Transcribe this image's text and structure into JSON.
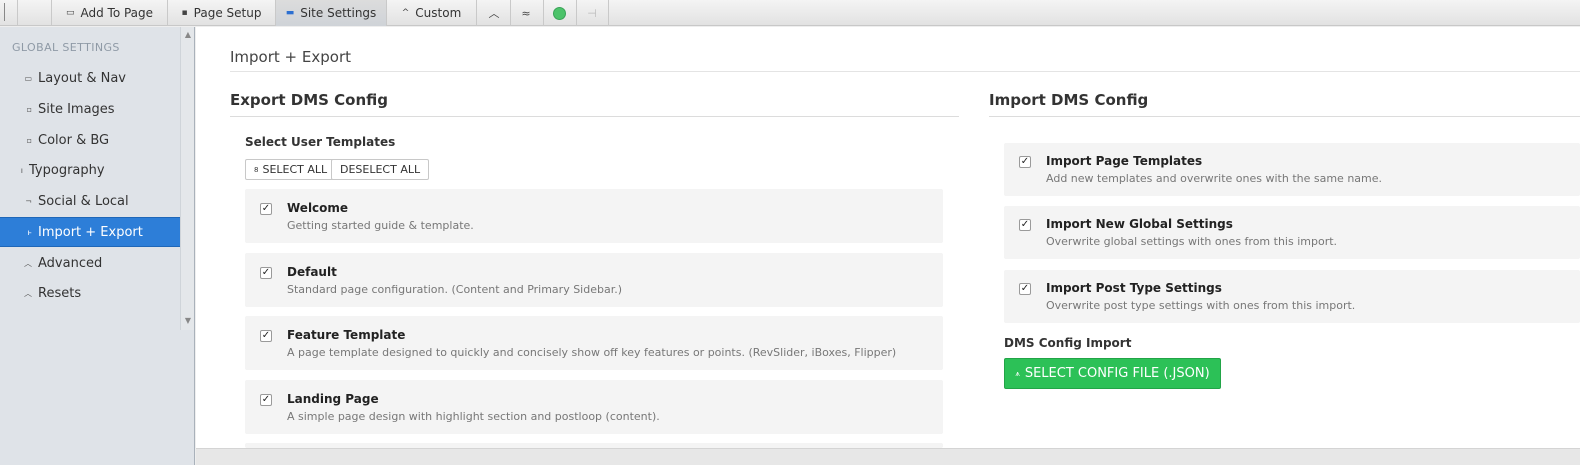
{
  "toolbar": {
    "add_to_page": "Add To Page",
    "page_setup": "Page Setup",
    "site_settings": "Site Settings",
    "custom": "Custom",
    "icons": [
      "drawer-handle-icon",
      "page-icon",
      "page-setup-icon",
      "site-settings-icon",
      "caret-up-icon",
      "chevron-up-icon",
      "double-chevron-icon",
      "status-dot-icon",
      "pin-icon"
    ],
    "status_color": "#4cc36a"
  },
  "sidebar": {
    "heading": "GLOBAL SETTINGS",
    "items": [
      {
        "label": "Layout & Nav",
        "icon": "layout-icon"
      },
      {
        "label": "Site Images",
        "icon": "images-icon"
      },
      {
        "label": "Color & BG",
        "icon": "color-icon"
      },
      {
        "label": "Typography",
        "icon": "typography-icon"
      },
      {
        "label": "Social & Local",
        "icon": "social-icon"
      },
      {
        "label": "Import + Export",
        "icon": "import-export-icon",
        "active": true
      },
      {
        "label": "Advanced",
        "icon": "advanced-icon"
      },
      {
        "label": "Resets",
        "icon": "resets-icon"
      }
    ],
    "accent_color": "#2d7ed8"
  },
  "panel": {
    "title": "Import + Export",
    "export": {
      "title": "Export DMS Config",
      "select_label": "Select User Templates",
      "select_all": "SELECT ALL",
      "deselect_all": "DESELECT ALL",
      "templates": [
        {
          "title": "Welcome",
          "desc": "Getting started guide & template.",
          "checked": true
        },
        {
          "title": "Default",
          "desc": "Standard page configuration. (Content and Primary Sidebar.)",
          "checked": true
        },
        {
          "title": "Feature Template",
          "desc": "A page template designed to quickly and concisely show off key features or points. (RevSlider, iBoxes, Flipper)",
          "checked": true
        },
        {
          "title": "Landing Page",
          "desc": "A simple page design with highlight section and postloop (content).",
          "checked": true
        }
      ]
    },
    "import": {
      "title": "Import DMS Config",
      "options": [
        {
          "title": "Import Page Templates",
          "desc": "Add new templates and overwrite ones with the same name.",
          "checked": true
        },
        {
          "title": "Import New Global Settings",
          "desc": "Overwrite global settings with ones from this import.",
          "checked": true
        },
        {
          "title": "Import Post Type Settings",
          "desc": "Overwrite post type settings with ones from this import.",
          "checked": true
        }
      ],
      "file_label": "DMS Config Import",
      "file_button": "SELECT CONFIG FILE (.JSON)",
      "button_color": "#2cc157"
    }
  }
}
